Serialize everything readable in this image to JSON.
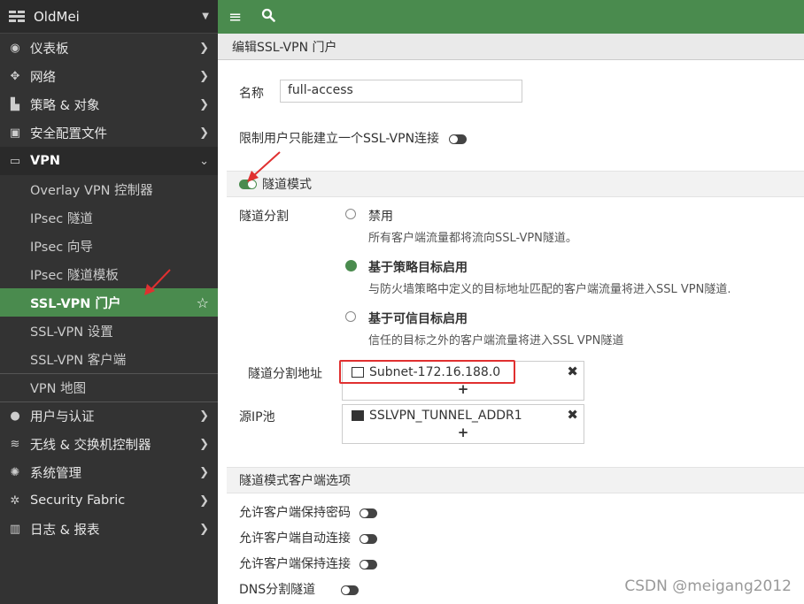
{
  "sidebar": {
    "app_name": "OldMei",
    "items": [
      {
        "icon": "dashboard-icon",
        "label": "仪表板",
        "glyph": "◉"
      },
      {
        "icon": "network-icon",
        "label": "网络",
        "glyph": "✥"
      },
      {
        "icon": "policy-icon",
        "label": "策略 & 对象",
        "glyph": "▙"
      },
      {
        "icon": "lock-icon",
        "label": "安全配置文件",
        "glyph": "🔒"
      },
      {
        "icon": "laptop-icon",
        "label": "VPN",
        "glyph": "▭"
      }
    ],
    "vpn_sub": [
      "Overlay VPN 控制器",
      "IPsec 隧道",
      "IPsec 向导",
      "IPsec 隧道模板",
      "SSL-VPN 门户",
      "SSL-VPN 设置",
      "SSL-VPN 客户端",
      "VPN 地图"
    ],
    "items_after": [
      {
        "icon": "user-icon",
        "label": "用户与认证",
        "glyph": "●"
      },
      {
        "icon": "wifi-icon",
        "label": "无线 & 交换机控制器",
        "glyph": "≋"
      },
      {
        "icon": "gear-icon",
        "label": "系统管理",
        "glyph": "✺"
      },
      {
        "icon": "fabric-icon",
        "label": "Security Fabric",
        "glyph": "✲"
      },
      {
        "icon": "chart-icon",
        "label": "日志 & 报表",
        "glyph": "▥"
      }
    ]
  },
  "topbar": {
    "menu_glyph": "≡",
    "search_glyph": "⚲"
  },
  "header": {
    "title": "编辑SSL-VPN 门户"
  },
  "form": {
    "name_label": "名称",
    "name_value": "full-access",
    "limit_label": "限制用户只能建立一个SSL-VPN连接",
    "tunnel_mode_label": "隧道模式",
    "split_label": "隧道分割",
    "options": [
      {
        "title": "禁用",
        "desc": "所有客户端流量都将流向SSL-VPN隧道。"
      },
      {
        "title": "基于策略目标启用",
        "desc": "与防火墙策略中定义的目标地址匹配的客户端流量将进入SSL VPN隧道."
      },
      {
        "title": "基于可信目标启用",
        "desc": "信任的目标之外的客户端流量将进入SSL VPN隧道"
      }
    ],
    "split_addr_label": "隧道分割地址",
    "split_addr_value": "Subnet-172.16.188.0",
    "source_pool_label": "源IP池",
    "source_pool_value": "SSLVPN_TUNNEL_ADDR1",
    "client_options_title": "隧道模式客户端选项",
    "client_options": [
      "允许客户端保持密码",
      "允许客户端自动连接",
      "允许客户端保持连接",
      "DNS分割隧道"
    ],
    "plus": "+",
    "remove": "✖"
  },
  "watermark": "CSDN @meigang2012"
}
